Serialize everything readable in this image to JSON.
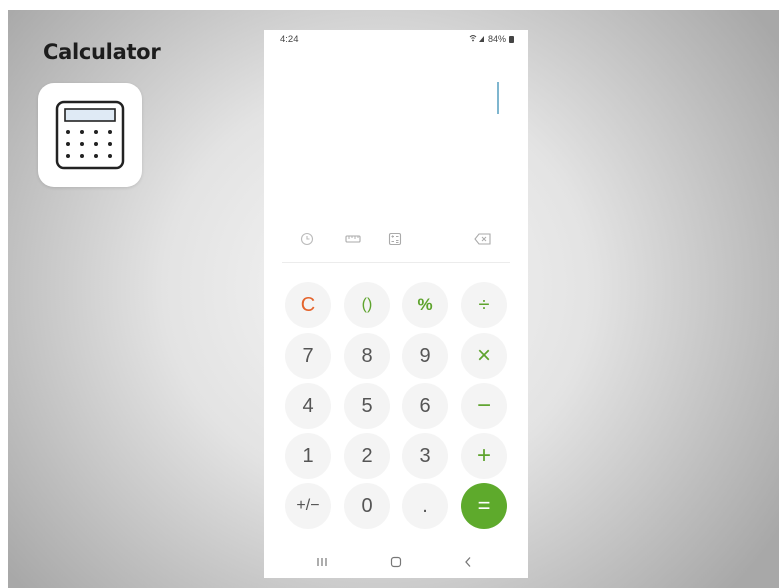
{
  "overlay": {
    "title": "Calculator",
    "icon": "calculator-icon"
  },
  "status_bar": {
    "time": "4:24",
    "battery": "84%",
    "icons": [
      "wifi-icon",
      "signal-icon",
      "battery-icon"
    ]
  },
  "display": {
    "expression": "",
    "cursor_visible": true
  },
  "toolbar": {
    "left_icons": [
      "history-icon",
      "unit-converter-icon",
      "scientific-mode-icon"
    ],
    "right_icon": "backspace-icon"
  },
  "keypad": {
    "rows": [
      [
        "C",
        "()",
        "%",
        "÷"
      ],
      [
        "7",
        "8",
        "9",
        "×"
      ],
      [
        "4",
        "5",
        "6",
        "−"
      ],
      [
        "1",
        "2",
        "3",
        "+"
      ],
      [
        "+/−",
        "0",
        ".",
        "="
      ]
    ]
  },
  "nav_bar": {
    "icons": [
      "recent-apps-icon",
      "home-icon",
      "back-icon"
    ]
  },
  "colors": {
    "clear_key": "#e4632b",
    "operator_key": "#5ea32d",
    "equals_bg": "#5eaa2c",
    "key_bg": "#f4f4f4"
  }
}
